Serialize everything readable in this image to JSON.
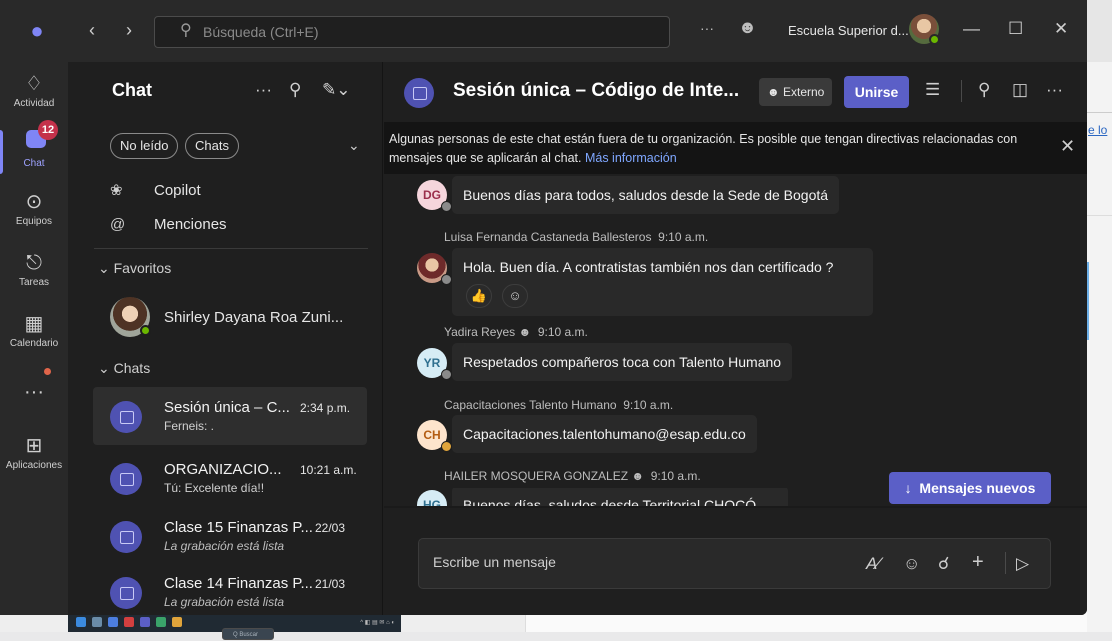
{
  "window": {
    "search_placeholder": "Búsqueda (Ctrl+E)",
    "org_name": "Escuela Superior d...",
    "more": "···"
  },
  "rail": {
    "items": [
      {
        "label": "Actividad"
      },
      {
        "label": "Chat",
        "badge": "12"
      },
      {
        "label": "Equipos"
      },
      {
        "label": "Tareas"
      },
      {
        "label": "Calendario"
      },
      {
        "label": "···"
      },
      {
        "label": "Aplicaciones"
      }
    ]
  },
  "chat_list": {
    "title": "Chat",
    "filters": [
      "No leído",
      "Chats"
    ],
    "shortcuts": [
      {
        "label": "Copilot"
      },
      {
        "label": "Menciones"
      }
    ],
    "favorites_header": "Favoritos",
    "favorites": [
      {
        "name": "Shirley Dayana Roa Zuni..."
      }
    ],
    "chats_header": "Chats",
    "conversations": [
      {
        "name": "Sesión única – C...",
        "time": "2:34 p.m.",
        "preview": "Ferneis: ."
      },
      {
        "name": "ORGANIZACIO...",
        "time": "10:21 a.m.",
        "preview": "Tú: Excelente día!!"
      },
      {
        "name": "Clase 15 Finanzas P...",
        "time": "22/03",
        "preview": "La grabación está lista"
      },
      {
        "name": "Clase 14 Finanzas P...",
        "time": "21/03",
        "preview": "La grabación está lista"
      }
    ]
  },
  "header": {
    "title": "Sesión única – Código de Inte...",
    "external_label": "Externo",
    "join_label": "Unirse"
  },
  "banner": {
    "text": "Algunas personas de este chat están fuera de tu organización. Es posible que tengan directivas relacionadas con mensajes que se aplicarán al chat.",
    "link": "Más información"
  },
  "messages": [
    {
      "initials": "DG",
      "author": "",
      "time": "",
      "text": "Buenos días para todos, saludos desde la Sede de Bogotá"
    },
    {
      "initials": "",
      "author": "Luisa Fernanda Castaneda Ballesteros",
      "time": "9:10 a.m.",
      "text": "Hola. Buen día. A contratistas también nos dan certificado ?"
    },
    {
      "initials": "YR",
      "author": "Yadira Reyes",
      "time": "9:10 a.m.",
      "text": "Respetados  compañeros toca con  Talento  Humano"
    },
    {
      "initials": "CH",
      "author": "Capacitaciones Talento Humano",
      "time": "9:10 a.m.",
      "text": "Capacitaciones.talentohumano@esap.edu.co"
    },
    {
      "initials": "HG",
      "author": "HAILER MOSQUERA GONZALEZ",
      "time": "9:10 a.m.",
      "text": "Buenos días, saludos desde Territorial CHOCÓ"
    }
  ],
  "new_messages_label": "Mensajes nuevos",
  "compose": {
    "placeholder": "Escribe un mensaje"
  },
  "background": {
    "link_fragment": "e lo"
  },
  "taskbar": {
    "search": "Q Buscar"
  },
  "colors": {
    "accent": "#5b5fc7",
    "rail_accent": "#7f85f5",
    "badge": "#c4314b",
    "presence": "#6bb700"
  }
}
